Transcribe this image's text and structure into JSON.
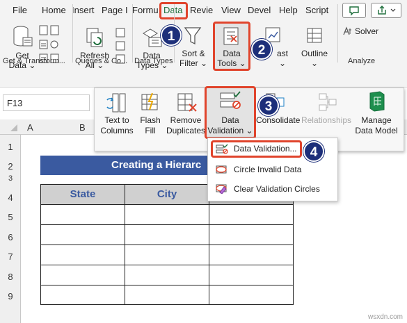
{
  "tabs": [
    "File",
    "Home",
    "Insert",
    "Page I",
    "Formu",
    "Data",
    "Revie",
    "View",
    "Devel",
    "Help",
    "Script"
  ],
  "ribbon": {
    "get_data": [
      "Get",
      "Data"
    ],
    "refresh_all": [
      "Refresh",
      "All"
    ],
    "data_types": [
      "Data",
      "Types"
    ],
    "sort_filter": [
      "Sort &",
      "Filter"
    ],
    "data_tools": [
      "Data",
      "Tools"
    ],
    "forecast": "ast",
    "outline": "Outline",
    "solver": "Solver",
    "groups": {
      "get_transform": "Get & Transform...",
      "queries": "Queries & Co...",
      "data_types": "Data Types",
      "analyze": "Analyze"
    }
  },
  "namebox": "F13",
  "columns": [
    "A",
    "B"
  ],
  "rows": [
    "1",
    "2",
    "3",
    "4",
    "5",
    "6",
    "7",
    "8",
    "9"
  ],
  "sheet": {
    "title": "Creating a Hierarc",
    "headers": [
      "State",
      "City",
      ""
    ]
  },
  "data_tools_panel": {
    "text_to_columns": [
      "Text to",
      "Columns"
    ],
    "flash_fill": [
      "Flash",
      "Fill"
    ],
    "remove_duplicates": [
      "Remove",
      "Duplicates"
    ],
    "data_validation": [
      "Data",
      "Validation"
    ],
    "consolidate": "Consolidate",
    "relationships": "Relationships",
    "manage_data_model": [
      "Manage",
      "Data Model"
    ]
  },
  "dropdown": {
    "items": [
      "Data Validation...",
      "Circle Invalid Data",
      "Clear Validation Circles"
    ]
  },
  "badges": [
    "1",
    "2",
    "3",
    "4"
  ],
  "watermark": "wsxdn.com",
  "colors": {
    "accent": "#e0442c",
    "badge": "#1d2f7a",
    "banner": "#3a5aa0",
    "excel_green": "#1e6e3c"
  }
}
